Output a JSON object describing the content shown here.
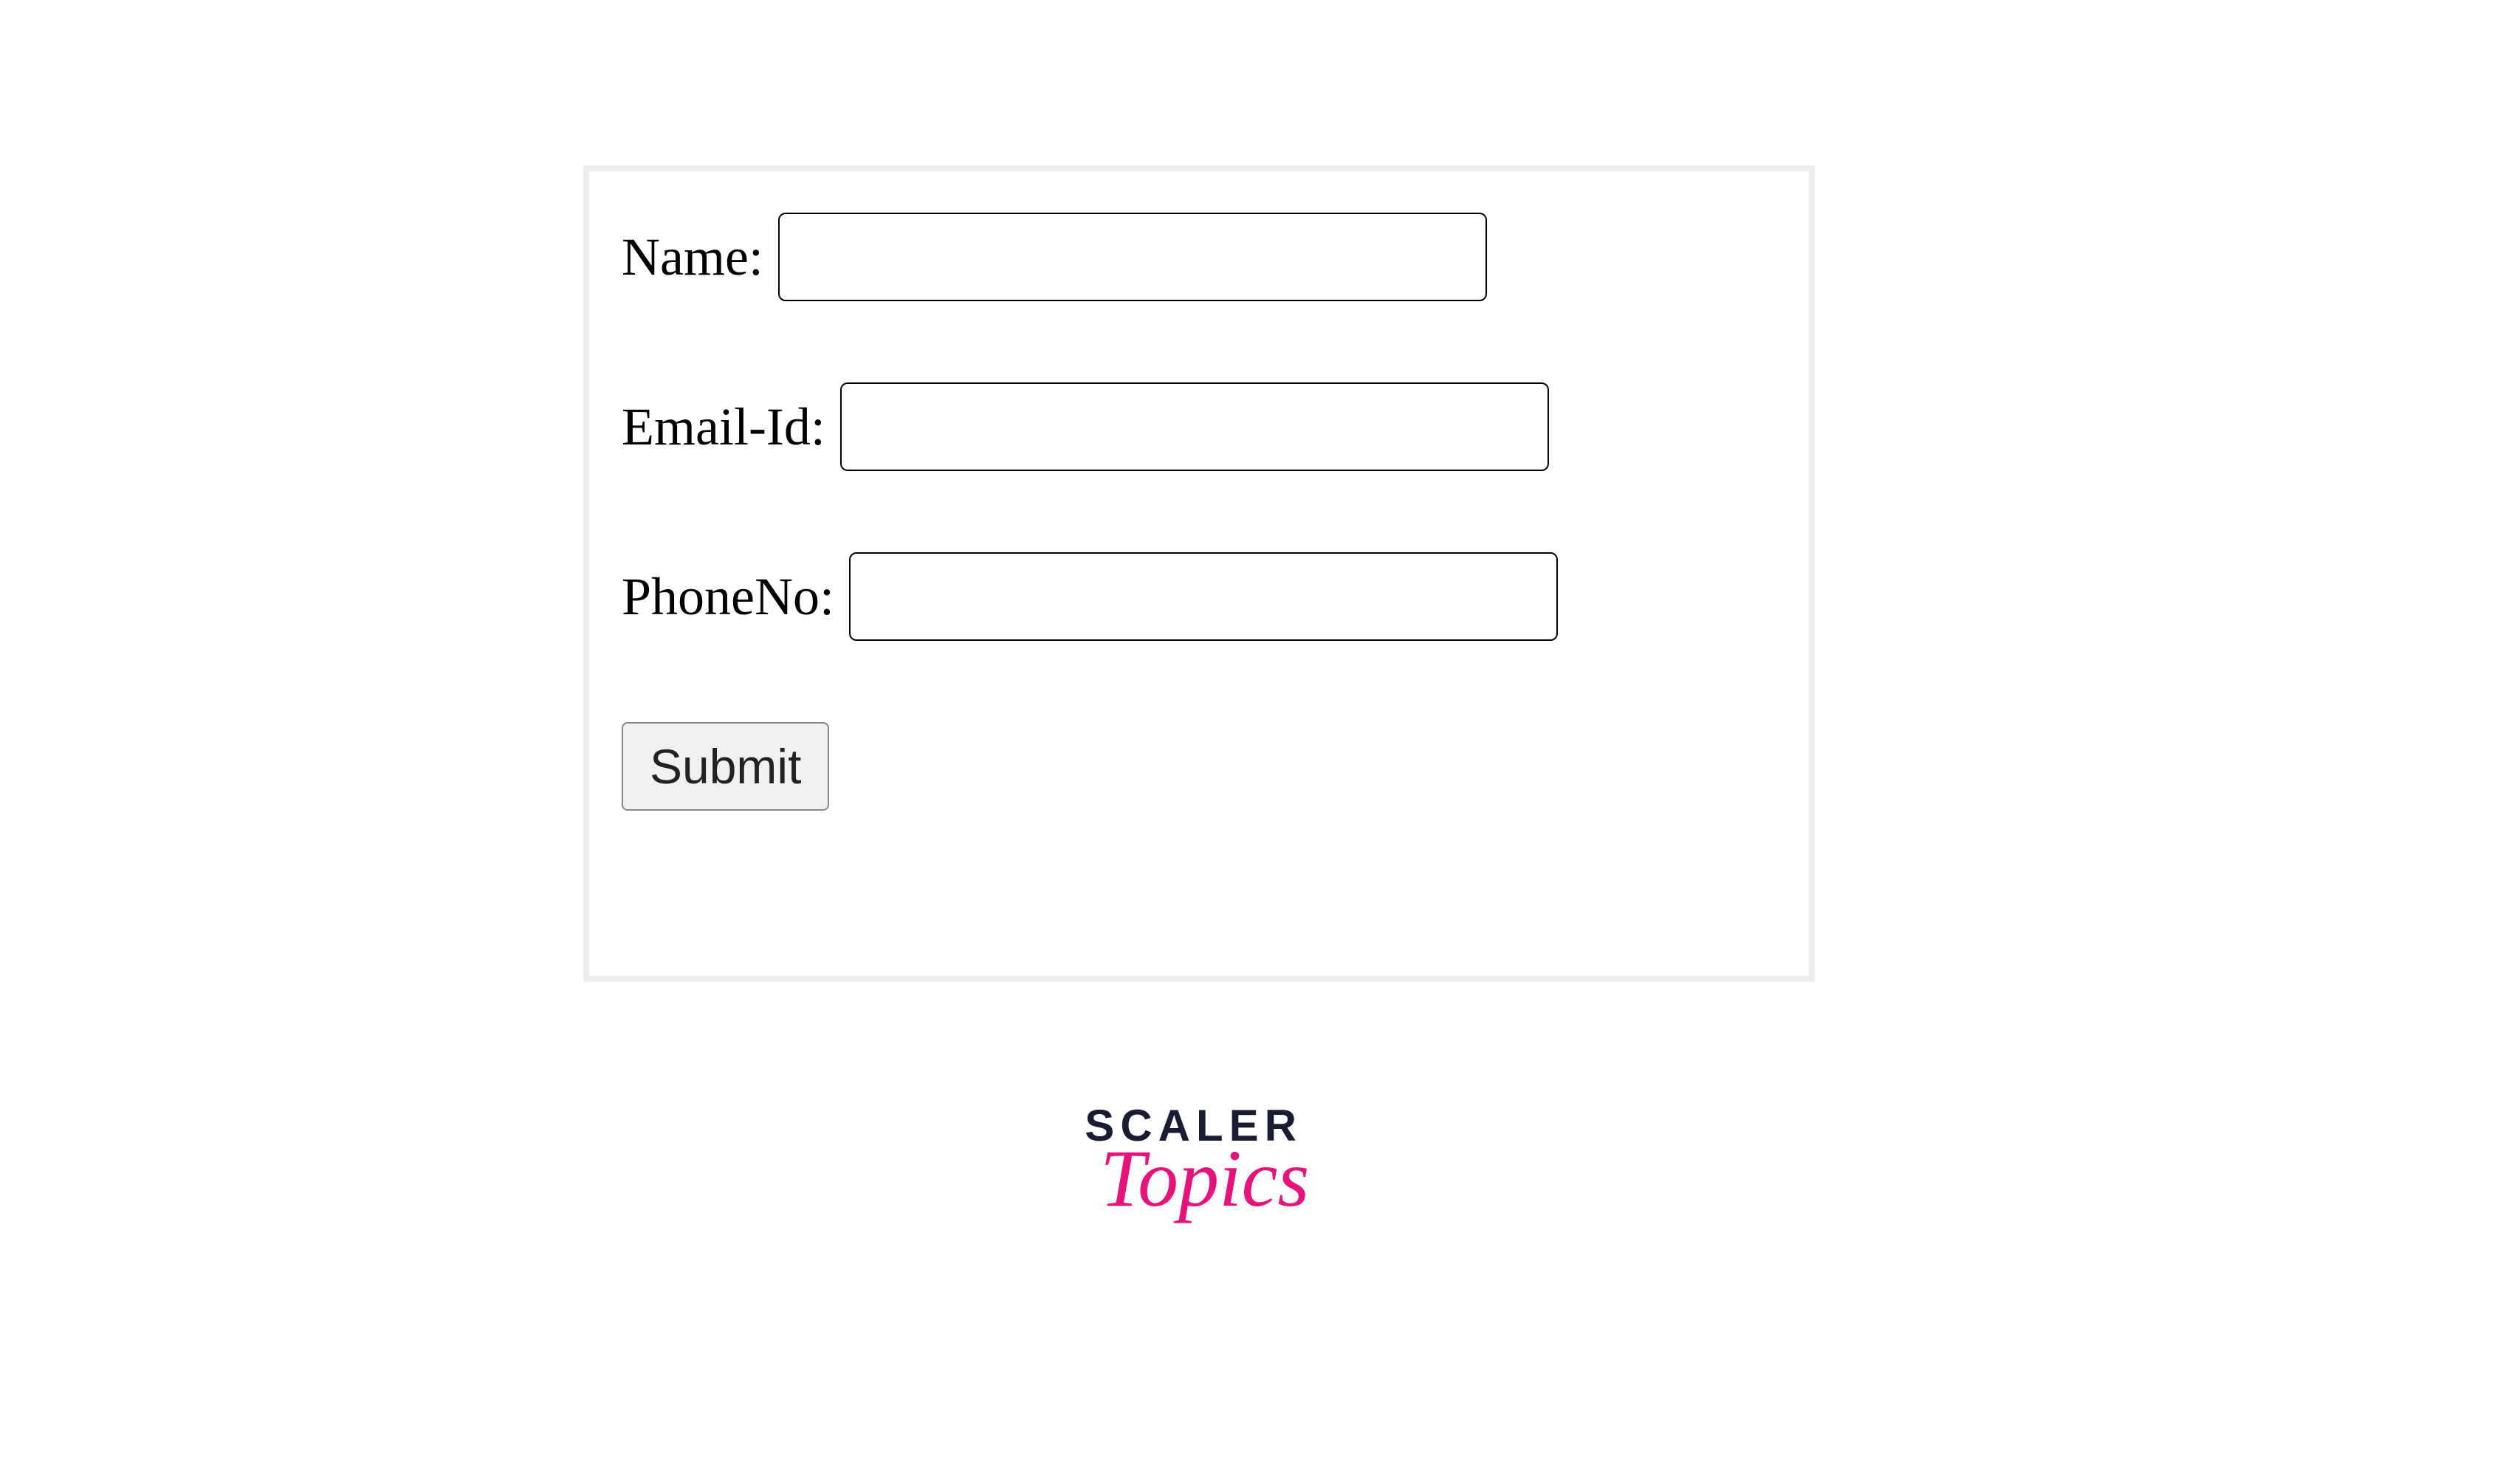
{
  "form": {
    "fields": {
      "name": {
        "label": "Name:",
        "value": ""
      },
      "email": {
        "label": "Email-Id:",
        "value": ""
      },
      "phone": {
        "label": "PhoneNo:",
        "value": ""
      }
    },
    "submit_label": "Submit"
  },
  "logo": {
    "line1": "SCALER",
    "line2": "Topics"
  }
}
